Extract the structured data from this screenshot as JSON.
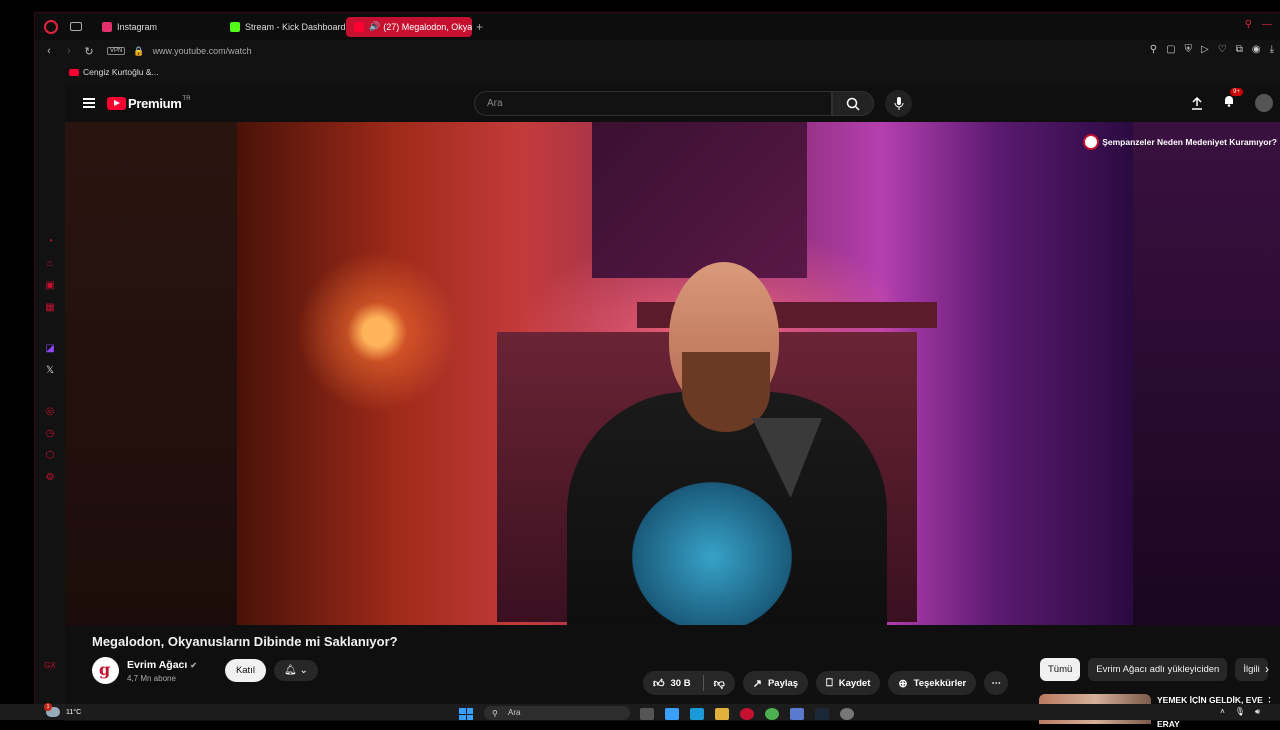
{
  "browser": {
    "tabs": [
      {
        "label": "Instagram",
        "color": "#e1306c"
      },
      {
        "label": "Stream - Kick Dashboard",
        "color": "#53fc18"
      },
      {
        "label": "(27) Megalodon, Okya",
        "color": "#ff0033"
      }
    ],
    "address": {
      "vpn": "VPN",
      "url": "www.youtube.com/watch"
    },
    "bookmark": "Cengiz Kurtoğlu &...",
    "sidebar_bottom": "GX"
  },
  "youtube": {
    "logo_text": "Premium",
    "logo_region": "TR",
    "search_placeholder": "Ara",
    "notif_count": "9+",
    "video": {
      "suggestion": "Şempanzeler Neden Medeniyet Kuramıyor?"
    },
    "title": "Megalodon, Okyanusların Dibinde mi Saklanıyor?",
    "channel": {
      "name": "Evrim Ağacı",
      "subs": "4,7 Mn abone",
      "join": "Katıl"
    },
    "actions": {
      "likes": "30 B",
      "share": "Paylaş",
      "save": "Kaydet",
      "thanks": "Teşekkürler"
    },
    "chips": [
      "Tümü",
      "Evrim Ağacı adlı yükleyiciden",
      "İlgili"
    ],
    "rec_title": "YEMEK İÇİN GELDİK, EVE ALMADILAR! ELBADEN, ERAY"
  },
  "taskbar": {
    "weather": "11°C",
    "search": "Ara",
    "accent": "#c5112f"
  }
}
